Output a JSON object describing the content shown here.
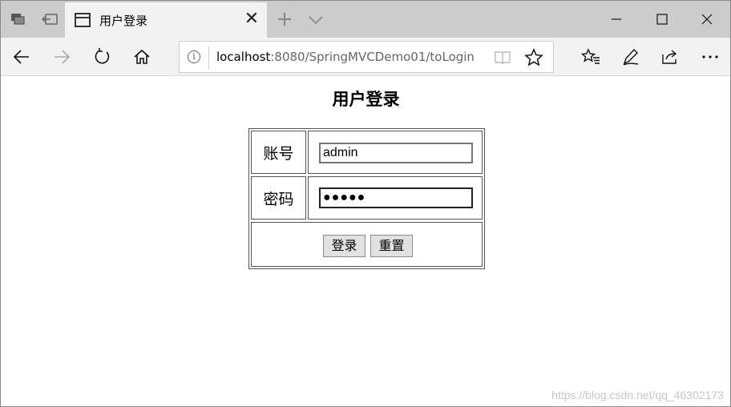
{
  "tab": {
    "title": "用户登录",
    "close_glyph": "✕"
  },
  "newtab_glyph": "+",
  "address": {
    "info_glyph": "i",
    "host": "localhost",
    "path": ":8080/SpringMVCDemo01/toLogin"
  },
  "page": {
    "heading": "用户登录",
    "account_label": "账号",
    "account_value": "admin",
    "password_label": "密码",
    "password_masked": "●●●●●",
    "login_button": "登录",
    "reset_button": "重置"
  },
  "watermark": "https://blog.csdn.net/qq_46302173",
  "icons": {
    "titlebar": [
      "tab-preview-icon",
      "set-aside-tabs-icon",
      "tab-icon",
      "close-icon",
      "plus-icon",
      "chevron-down-icon",
      "minimize-icon",
      "maximize-icon",
      "close-window-icon"
    ],
    "toolbar": [
      "back-arrow-icon",
      "forward-arrow-icon",
      "refresh-icon",
      "home-icon",
      "info-icon",
      "reading-view-icon",
      "star-icon",
      "favorites-icon",
      "pen-icon",
      "share-icon",
      "more-icon"
    ]
  }
}
